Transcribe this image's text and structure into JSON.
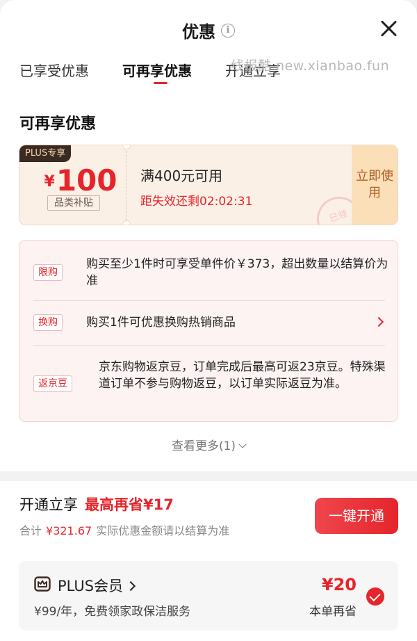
{
  "header": {
    "title": "优惠"
  },
  "tabs": [
    {
      "label": "已享受优惠"
    },
    {
      "label": "可再享优惠"
    },
    {
      "label": "开通立享"
    }
  ],
  "watermark": "线报酷 new.xianbao.fun",
  "section_title": "可再享优惠",
  "coupon": {
    "tag": "PLUS专享",
    "currency": "¥",
    "amount": "100",
    "category": "品类补贴",
    "condition": "满400元可用",
    "timer": "距失效还剩02:02:31",
    "stamp": "已领",
    "use_label": "立即使用"
  },
  "perks": [
    {
      "tag": "限购",
      "text": "购买至少1件时可享受单件价￥373，超出数量以结算价为准"
    },
    {
      "tag": "换购",
      "text": "购买1件可优惠换购热销商品"
    },
    {
      "tag": "返京豆",
      "text": "京东购物返京豆，订单完成后最高可返23京豆。特殊渠道订单不参与购物返豆，以订单实际返豆为准。"
    }
  ],
  "see_more": "查看更多(1)",
  "membership": {
    "title": "开通立享",
    "highlight": "最高再省¥17",
    "sum_label": "合计",
    "sum_amount": "¥321.67",
    "sum_note": "实际优惠金额请以结算为准",
    "open_button": "一键开通"
  },
  "plus_card": {
    "name": "PLUS会员",
    "desc": "¥99/年，免费领家政保洁服务",
    "save_amount": "¥20",
    "save_label": "本单再省"
  },
  "colors": {
    "accent": "#e5252b",
    "coupon_bg": "#fbf0e6",
    "perks_bg": "#fdf3f3"
  }
}
